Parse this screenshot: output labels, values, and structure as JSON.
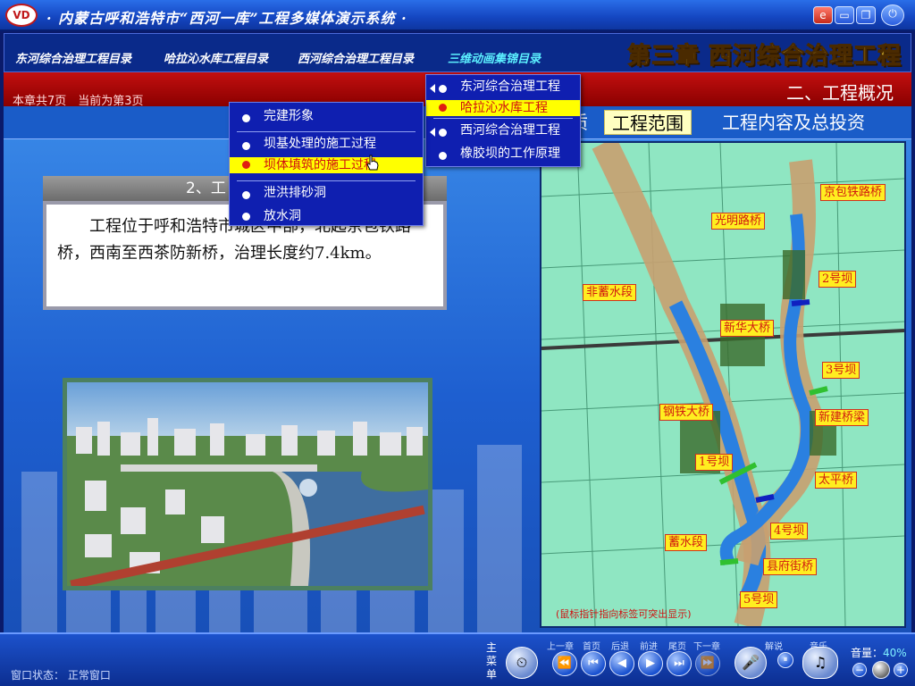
{
  "window": {
    "title": "· 内蒙古呼和浩特市“西河一库”工程多媒体演示系统 ·",
    "logo_text": "VD"
  },
  "nav": {
    "items": [
      {
        "label": "东河综合治理工程目录",
        "active": false
      },
      {
        "label": "哈拉沁水库工程目录",
        "active": false
      },
      {
        "label": "西河综合治理工程目录",
        "active": false
      },
      {
        "label": "三维动画集锦目录",
        "active": true
      }
    ],
    "chapter_title": "第三章 西河综合治理工程"
  },
  "page_info": "本章共7页　当前为第3页",
  "section_title": "二、工程概况",
  "tabs": [
    {
      "label": "质",
      "active": false
    },
    {
      "label": "工程范围",
      "active": true
    },
    {
      "label": "工程内容及总投资",
      "active": false
    }
  ],
  "description": {
    "heading": "2、工",
    "body": "工程位于呼和浩特市城区中部，北起京包铁路桥，西南至西茶防新桥，治理长度约7.4km。"
  },
  "main_menu": {
    "items": [
      {
        "label": "东河综合治理工程",
        "highlight": false,
        "submenu": true
      },
      {
        "label": "哈拉沁水库工程",
        "highlight": true,
        "submenu": false
      },
      {
        "label": "西河综合治理工程",
        "highlight": false,
        "submenu": true
      },
      {
        "label": "橡胶坝的工作原理",
        "highlight": false,
        "submenu": false
      }
    ]
  },
  "sub_menu": {
    "items": [
      {
        "label": "完建形象",
        "highlight": false
      },
      {
        "label": "坝基处理的施工过程",
        "highlight": false
      },
      {
        "label": "坝体填筑的施工过程",
        "highlight": true
      },
      {
        "label": "泄洪排砂洞",
        "highlight": false
      },
      {
        "label": "放水洞",
        "highlight": false
      }
    ]
  },
  "map": {
    "labels": [
      "京包铁路桥",
      "光明路桥",
      "2号坝",
      "非蓄水段",
      "新华大桥",
      "3号坝",
      "钢铁大桥",
      "新建桥梁",
      "1号坝",
      "太平桥",
      "4号坝",
      "蓄水段",
      "县府街桥",
      "5号坝"
    ],
    "hint": "(鼠标指针指向标签可突出显示)"
  },
  "bottom": {
    "status_label": "窗口状态：",
    "status_value": "正常窗口",
    "main_menu_label": "主菜单",
    "controls": [
      "上一章",
      "首页",
      "后退",
      "前进",
      "尾页",
      "下一章"
    ],
    "narration_label": "解说",
    "music_label": "音乐",
    "volume_label": "音量：",
    "volume_value": "40%"
  },
  "colors": {
    "accent_yellow": "#ffe040",
    "nav_active": "#5cf0ff",
    "menu_bg": "#0f1fb0",
    "highlight": "#ffff00",
    "red_band": "#c20f0f"
  }
}
